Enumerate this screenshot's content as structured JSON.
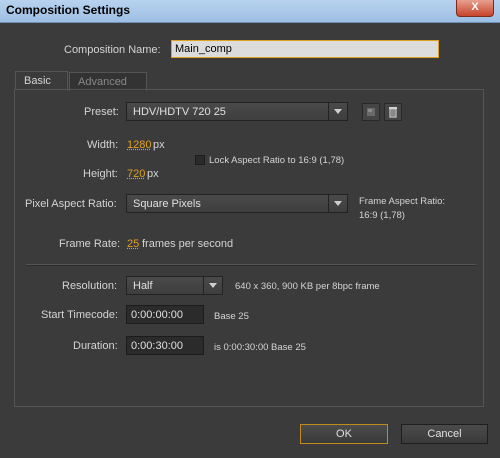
{
  "window": {
    "title": "Composition Settings",
    "close_label": "X"
  },
  "composition_name": {
    "label": "Composition Name:",
    "value": "Main_comp"
  },
  "tabs": [
    {
      "label": "Basic"
    },
    {
      "label": "Advanced"
    }
  ],
  "preset": {
    "label": "Preset:",
    "value": "HDV/HDTV 720 25"
  },
  "width": {
    "label": "Width:",
    "value": "1280",
    "unit": "px"
  },
  "height": {
    "label": "Height:",
    "value": "720",
    "unit": "px"
  },
  "lock_aspect": {
    "label": "Lock Aspect Ratio to 16:9 (1,78)",
    "checked": false
  },
  "pixel_aspect": {
    "label": "Pixel Aspect Ratio:",
    "value": "Square Pixels",
    "frame_aspect_label": "Frame Aspect Ratio:",
    "frame_aspect_value": "16:9 (1,78)"
  },
  "frame_rate": {
    "label": "Frame Rate:",
    "value": "25",
    "unit": "frames per second"
  },
  "resolution": {
    "label": "Resolution:",
    "value": "Half",
    "info": "640 x 360, 900 KB per 8bpc frame"
  },
  "start_timecode": {
    "label": "Start Timecode:",
    "value": "0:00:00:00",
    "base": "Base 25"
  },
  "duration": {
    "label": "Duration:",
    "value": "0:00:30:00",
    "info": "is 0:00:30:00  Base 25"
  },
  "buttons": {
    "ok": "OK",
    "cancel": "Cancel"
  },
  "icons": {
    "preset_save": "save-preset-icon",
    "preset_delete": "trash-icon"
  },
  "colors": {
    "accent": "#e0a020",
    "background": "#3b3b3b"
  }
}
